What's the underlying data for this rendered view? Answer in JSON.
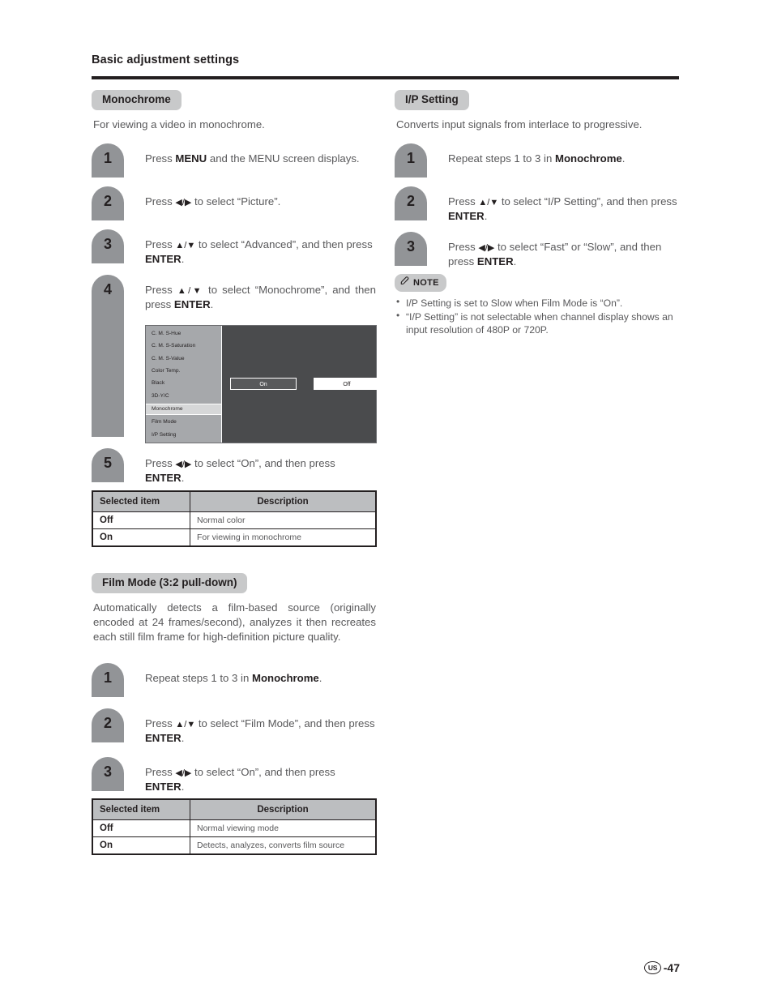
{
  "header": {
    "title": "Basic adjustment settings"
  },
  "left_column": {
    "monochrome": {
      "pill_label": "Monochrome",
      "description": "For viewing a video in monochrome.",
      "steps": [
        {
          "num": "1",
          "html": "Press <b>MENU</b> and the MENU screen displays."
        },
        {
          "num": "2",
          "html": "Press <span class=\"arrows\">◀/▶</span> to select “Picture”."
        },
        {
          "num": "3",
          "html": "Press <span class=\"arrows\">▲/▼</span> to select “Advanced”, and then press <b>ENTER</b>."
        },
        {
          "num": "4",
          "html": "Press <span class=\"arrows\">▲/▼</span> to select “Monochrome”, and then press <b>ENTER</b>."
        },
        {
          "num": "5",
          "html": "Press <span class=\"arrows\">◀/▶</span> to select “On”, and then press <b>ENTER</b>."
        }
      ],
      "osd": {
        "items": [
          {
            "label": "C. M. S-Hue",
            "selected": false
          },
          {
            "label": "C. M. S-Saturation",
            "selected": false
          },
          {
            "label": "C. M. S-Value",
            "selected": false
          },
          {
            "label": "Color Temp.",
            "selected": false
          },
          {
            "label": "Black",
            "selected": false
          },
          {
            "label": "3D-Y/C",
            "selected": false
          },
          {
            "label": "Monochrome",
            "selected": true
          },
          {
            "label": "Film Mode",
            "selected": false
          },
          {
            "label": "I/P Setting",
            "selected": false
          }
        ],
        "button_on": "On",
        "button_off": "Off"
      },
      "table": {
        "headers": [
          "Selected item",
          "Description"
        ],
        "rows": [
          [
            "Off",
            "Normal color"
          ],
          [
            "On",
            "For viewing in monochrome"
          ]
        ]
      }
    },
    "film_mode": {
      "pill_label": "Film Mode (3:2 pull-down)",
      "description": "Automatically detects a film-based source (originally encoded at 24 frames/second), analyzes it then recreates each still film frame for high-definition picture quality.",
      "steps": [
        {
          "num": "1",
          "html": "Repeat steps 1 to 3 in <b>Monochrome</b>."
        },
        {
          "num": "2",
          "html": "Press <span class=\"arrows\">▲/▼</span> to select “Film Mode”, and then press <b>ENTER</b>."
        },
        {
          "num": "3",
          "html": "Press <span class=\"arrows\">◀/▶</span> to select “On”, and then press <b>ENTER</b>."
        }
      ],
      "table": {
        "headers": [
          "Selected item",
          "Description"
        ],
        "rows": [
          [
            "Off",
            "Normal viewing mode"
          ],
          [
            "On",
            "Detects, analyzes, converts film source"
          ]
        ]
      }
    }
  },
  "right_column": {
    "ip_setting": {
      "pill_label": "I/P Setting",
      "description": "Converts input signals from interlace to progressive.",
      "steps": [
        {
          "num": "1",
          "html": "Repeat steps 1 to 3 in <b>Monochrome</b>."
        },
        {
          "num": "2",
          "html": "Press <span class=\"arrows\">▲/▼</span> to select “I/P Setting”, and then press <b>ENTER</b>."
        },
        {
          "num": "3",
          "html": "Press <span class=\"arrows\">◀/▶</span> to select “Fast” or “Slow”, and then press <b>ENTER</b>."
        }
      ],
      "note": {
        "label": "NOTE",
        "icon": "pen-nib-icon",
        "bullets": [
          "I/P Setting is set to Slow when Film Mode is “On”.",
          "“I/P Setting” is not selectable when channel display shows an input resolution of 480P or 720P."
        ]
      }
    }
  },
  "footer": {
    "region": "US",
    "page_number": "-47"
  },
  "colors": {
    "pill_gray": "#c8c9ca",
    "badge_gray": "#929497",
    "text_gray": "#58585a",
    "ink": "#231f20",
    "table_header": "#bcbec0",
    "osd_list_bg": "#a6a8ab",
    "osd_panel_bg": "#4a4b4d"
  }
}
